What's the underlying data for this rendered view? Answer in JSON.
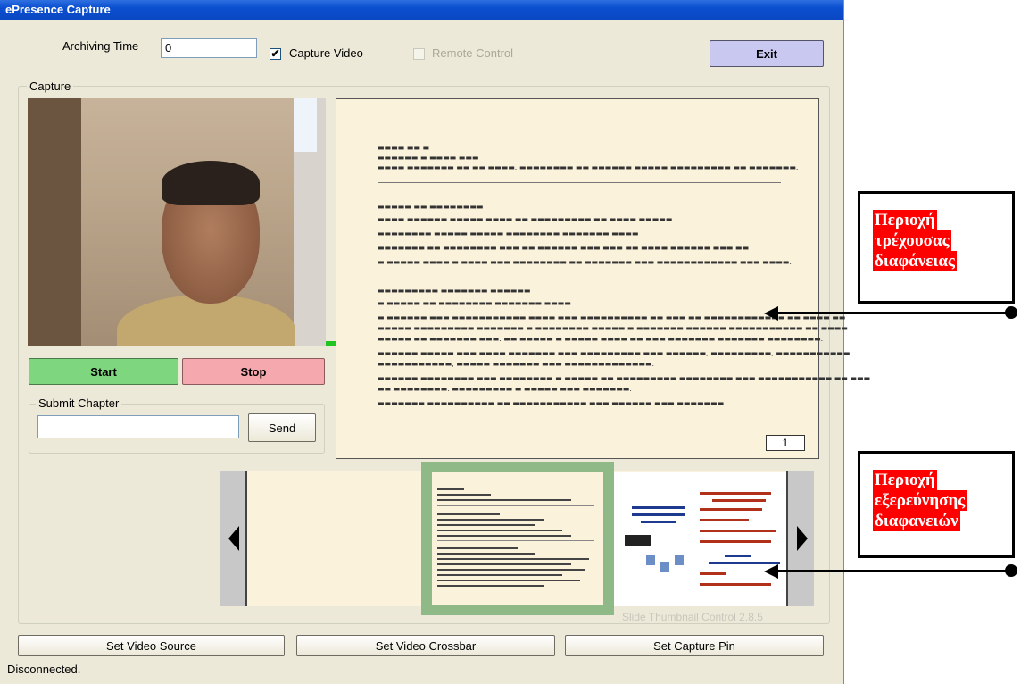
{
  "window": {
    "title": "ePresence Capture",
    "archiving_time_label": "Archiving Time",
    "archiving_time_value": "0",
    "capture_video_label": "Capture Video",
    "capture_video_checked": "✔",
    "remote_control_label": "Remote Control",
    "exit_label": "Exit",
    "capture_group_label": "Capture",
    "start_label": "Start",
    "stop_label": "Stop",
    "submit_chapter_label": "Submit Chapter",
    "send_label": "Send",
    "current_slide_number": "1",
    "thumbnail_caption": "Slide Thumbnail Control 2.8.5",
    "set_video_source_label": "Set Video Source",
    "set_video_crossbar_label": "Set Video Crossbar",
    "set_capture_pin_label": "Set Capture Pin",
    "status": "Disconnected."
  },
  "annotations": {
    "current_slide_area": [
      "Περιοχή",
      "τρέχουσας",
      "διαφάνειας"
    ],
    "slide_browser_area": [
      "Περιοχή",
      "εξερεύνησης",
      "διαφανειών"
    ]
  },
  "colors": {
    "start_button": "#7ed67e",
    "stop_button": "#f5a8ae",
    "exit_button": "#c8c8f0",
    "slide_background": "#fbf2dc",
    "selected_thumbnail_frame": "#8fb987",
    "annotation_highlight": "#ff0000"
  }
}
